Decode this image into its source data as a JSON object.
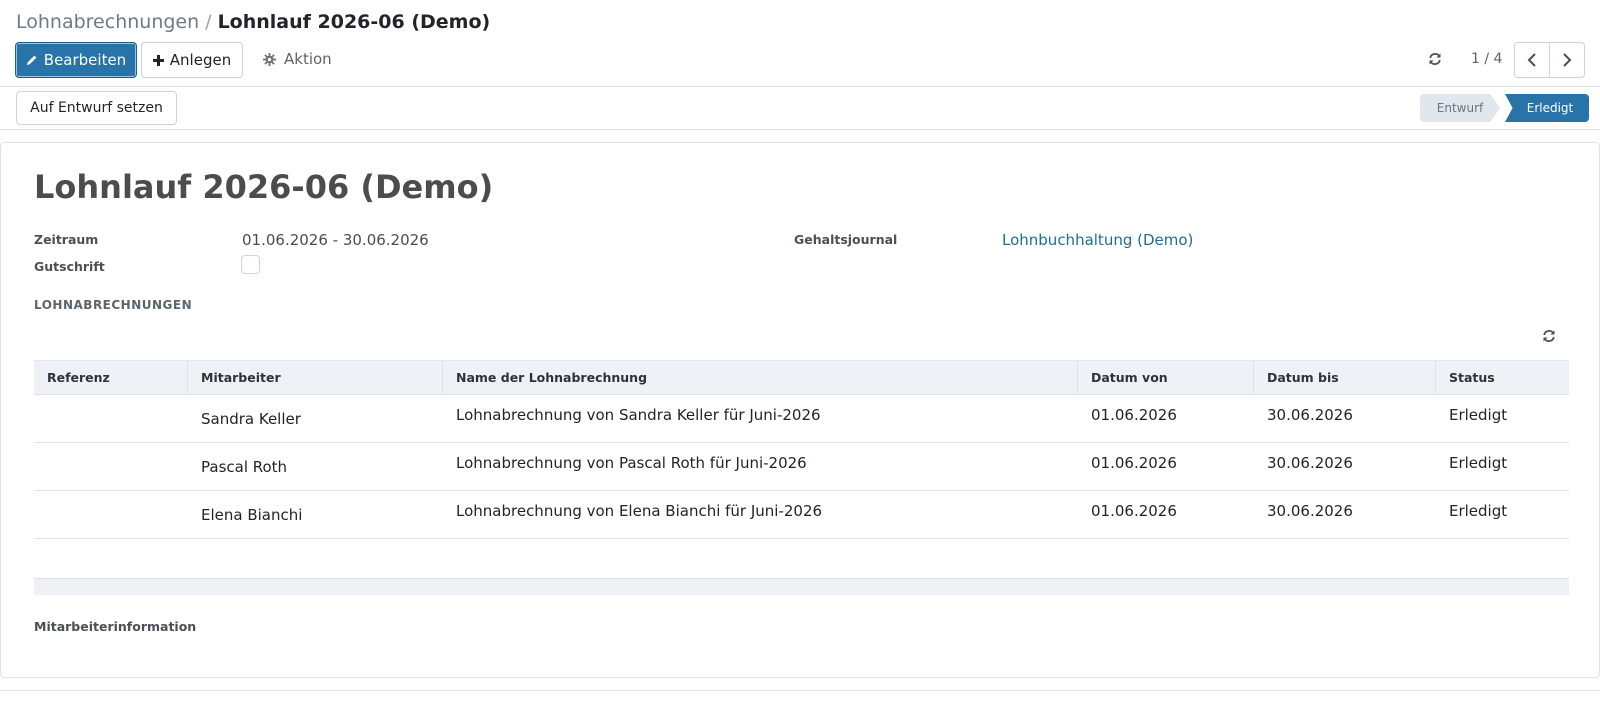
{
  "breadcrumb": {
    "parent": "Lohnabrechnungen",
    "separator": "/",
    "current": "Lohnlauf 2026-06 (Demo)"
  },
  "toolbar": {
    "edit_label": "Bearbeiten",
    "create_label": "Anlegen",
    "action_label": "Aktion"
  },
  "pager": {
    "value": "1 / 4"
  },
  "statusbar": {
    "draft_button": "Auf Entwurf setzen",
    "stages": [
      "Entwurf",
      "Erledigt"
    ],
    "active_stage": "Erledigt"
  },
  "form": {
    "title": "Lohnlauf 2026-06 (Demo)",
    "period_label": "Zeitraum",
    "period_value": "01.06.2026 - 30.06.2026",
    "credit_label": "Gutschrift",
    "credit_checked": false,
    "journal_label": "Gehaltsjournal",
    "journal_value": "Lohnbuchhaltung (Demo)"
  },
  "payslips": {
    "section_title": "LOHNABRECHNUNGEN",
    "columns": [
      "Referenz",
      "Mitarbeiter",
      "Name der Lohnabrechnung",
      "Datum von",
      "Datum bis",
      "Status"
    ],
    "rows": [
      {
        "reference": "",
        "employee": "Sandra Keller",
        "name": "Lohnabrechnung von Sandra Keller für Juni-2026",
        "date_from": "01.06.2026",
        "date_to": "30.06.2026",
        "status": "Erledigt"
      },
      {
        "reference": "",
        "employee": "Pascal Roth",
        "name": "Lohnabrechnung von Pascal Roth für Juni-2026",
        "date_from": "01.06.2026",
        "date_to": "30.06.2026",
        "status": "Erledigt"
      },
      {
        "reference": "",
        "employee": "Elena Bianchi",
        "name": "Lohnabrechnung von Elena Bianchi für Juni-2026",
        "date_from": "01.06.2026",
        "date_to": "30.06.2026",
        "status": "Erledigt"
      }
    ]
  },
  "employee_info": {
    "title": "Mitarbeiterinformation"
  },
  "colors": {
    "primary": "#2873a8",
    "link": "#1f6e94",
    "header_bg": "#eef2f7",
    "stage_inactive": "#e2e7ee"
  },
  "icons": {
    "edit": "pencil-icon",
    "create": "plus-icon",
    "action": "gear-icon",
    "refresh": "refresh-icon",
    "prev": "chevron-left-icon",
    "next": "chevron-right-icon"
  }
}
